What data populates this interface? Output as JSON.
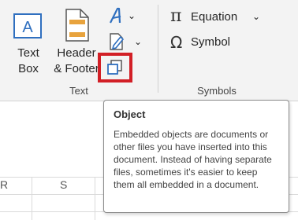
{
  "ribbon": {
    "text_group": {
      "label": "Text",
      "text_box": {
        "label_line1": "Text",
        "label_line2": "Box",
        "icon": "text-box-icon"
      },
      "header_footer": {
        "label_line1": "Header",
        "label_line2": "& Footer",
        "icon": "header-footer-icon"
      },
      "wordart": {
        "icon": "wordart-icon"
      },
      "signature_line": {
        "icon": "signature-line-icon"
      },
      "object": {
        "icon": "object-icon"
      }
    },
    "symbols_group": {
      "label": "Symbols",
      "equation": {
        "label": "Equation",
        "icon": "pi-icon"
      },
      "symbol": {
        "label": "Symbol",
        "icon": "omega-icon"
      }
    }
  },
  "tooltip": {
    "title": "Object",
    "body": "Embedded objects are documents or other files you have inserted into this document. Instead of having separate files, sometimes it's easier to keep them all embedded in a document."
  },
  "sheet": {
    "columns": [
      "R",
      "S"
    ]
  },
  "colors": {
    "ribbon_bg": "#f3f3f3",
    "highlight": "#d21f26",
    "accent_blue": "#2f6fbf",
    "accent_orange": "#e8a33d"
  }
}
